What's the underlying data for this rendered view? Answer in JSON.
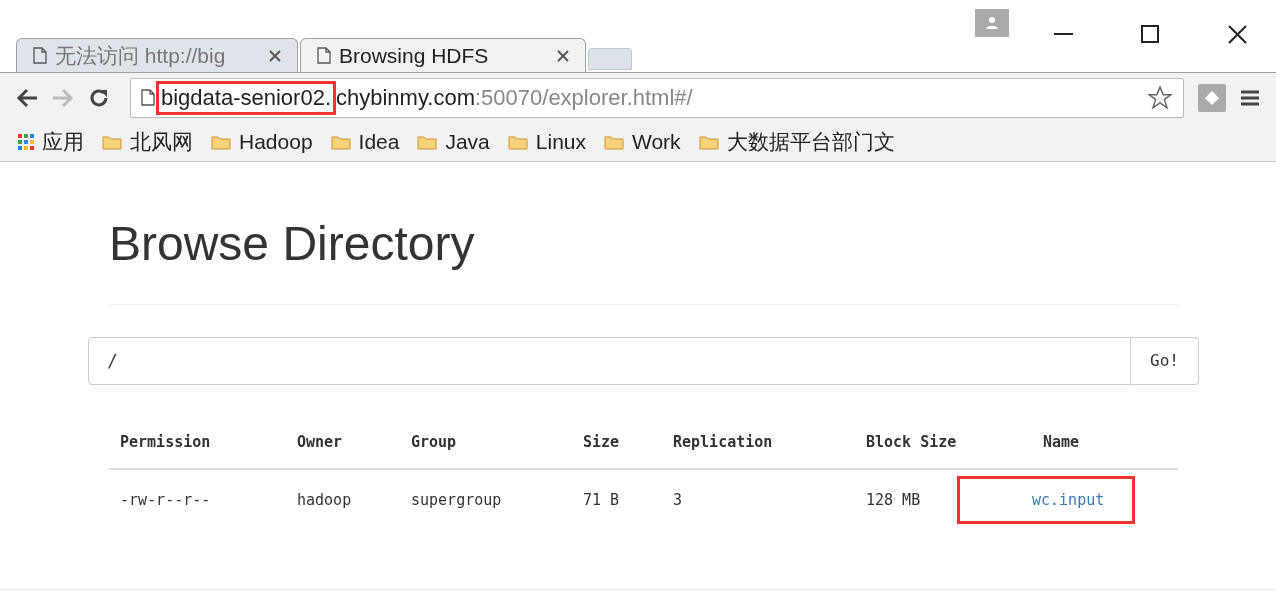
{
  "browser": {
    "tabs": [
      {
        "title": "无法访问 http://big",
        "selected": false
      },
      {
        "title": "Browsing HDFS",
        "selected": true
      }
    ],
    "url": [
      {
        "text": "bigdata-senior02.",
        "kind": "host",
        "highlighted": true
      },
      {
        "text": "chybinmy.com",
        "kind": "host",
        "highlighted": false
      },
      {
        "text": ":50070/explorer.html#/",
        "kind": "path",
        "highlighted": false
      }
    ],
    "bookmarks": [
      {
        "label": "应用",
        "kind": "apps"
      },
      {
        "label": "北风网",
        "kind": "folder"
      },
      {
        "label": "Hadoop",
        "kind": "folder"
      },
      {
        "label": "Idea",
        "kind": "folder"
      },
      {
        "label": "Java",
        "kind": "folder"
      },
      {
        "label": "Linux",
        "kind": "folder"
      },
      {
        "label": "Work",
        "kind": "folder"
      },
      {
        "label": "大数据平台部门文",
        "kind": "folder"
      }
    ]
  },
  "page": {
    "title": "Browse Directory",
    "path_field": {
      "value": "/"
    },
    "go_button": "Go!",
    "table": {
      "columns": [
        "Permission",
        "Owner",
        "Group",
        "Size",
        "Replication",
        "Block Size",
        "Name"
      ],
      "rows": [
        {
          "cells": [
            "-rw-r--r--",
            "hadoop",
            "supergroup",
            "71 B",
            "3",
            "128 MB"
          ],
          "name": "wc.input",
          "highlighted": true
        }
      ]
    }
  }
}
